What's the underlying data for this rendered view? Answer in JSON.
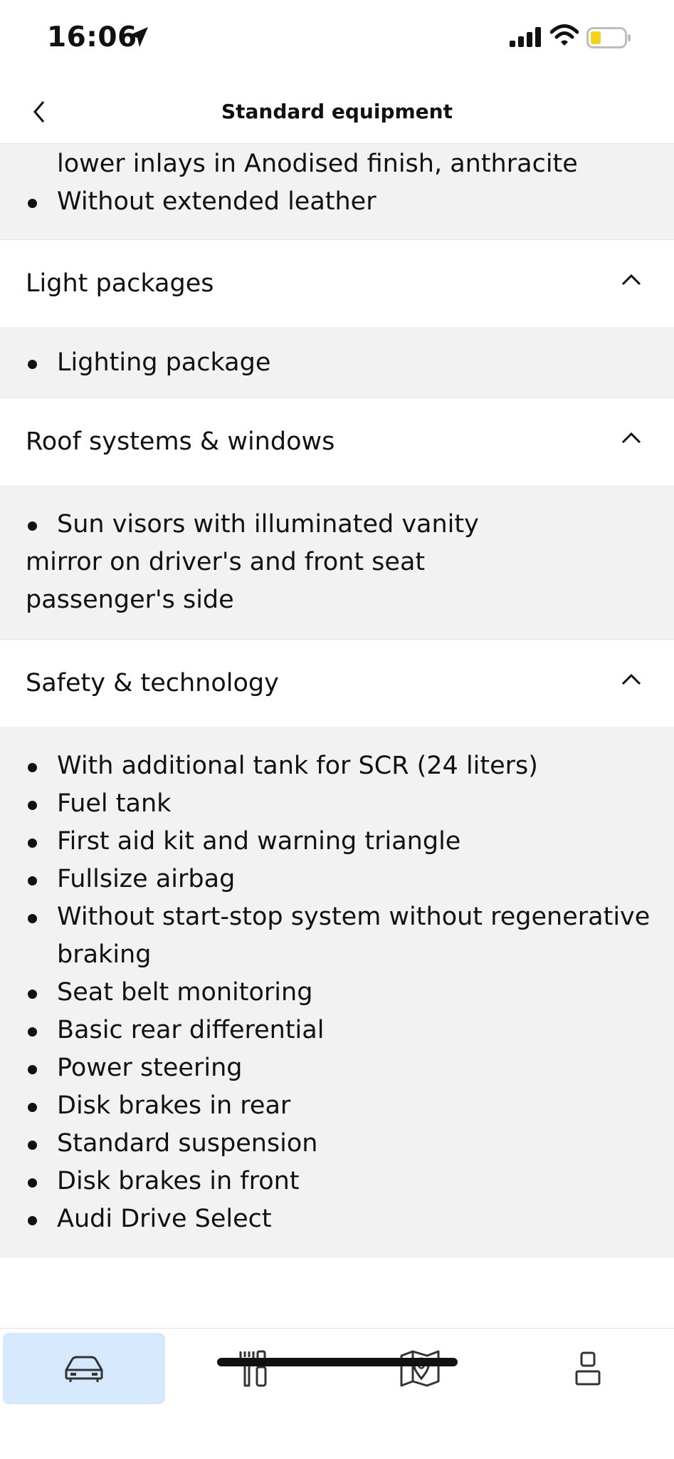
{
  "status_bar": {
    "time": "16:06"
  },
  "nav": {
    "title": "Standard equipment"
  },
  "top_items": {
    "continuation": "lower inlays in Anodised finish, anthracite",
    "items": [
      "Without extended leather"
    ]
  },
  "sections": [
    {
      "title": "Light packages",
      "items": [
        "Lighting package"
      ]
    },
    {
      "title": "Roof systems & windows",
      "item_lines": [
        "Sun visors with illuminated vanity",
        "mirror on driver's and front seat",
        "passenger's side"
      ]
    },
    {
      "title": "Safety & technology",
      "items": [
        "With additional tank for SCR (24 liters)",
        "Fuel tank",
        "First aid kit and warning triangle",
        "Fullsize airbag",
        "Without start-stop system without regenerative",
        "braking",
        "Seat belt monitoring",
        "Basic rear differential",
        "Power steering",
        "Disk brakes in rear",
        "Standard suspension",
        "Disk brakes in front",
        "Audi Drive Select"
      ]
    }
  ],
  "tab_bar": {
    "tabs": [
      {
        "icon": "car-icon",
        "active": true
      },
      {
        "icon": "tools-icon",
        "active": false
      },
      {
        "icon": "map-pin-icon",
        "active": false
      },
      {
        "icon": "user-icon",
        "active": false
      }
    ],
    "accent_color": "#d6e8fb"
  }
}
